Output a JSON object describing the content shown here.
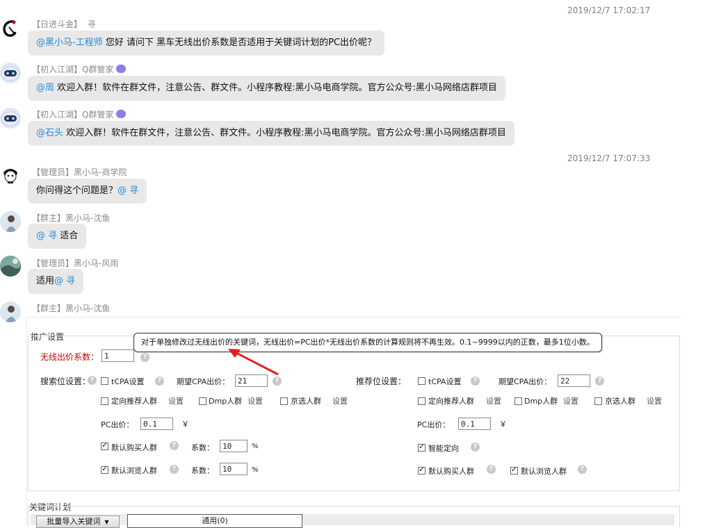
{
  "messages": [
    {
      "id": "m1",
      "timestamp": "2019/12/7 17:02:17",
      "role": "【日进斗金】",
      "name": "寻",
      "mention": "@黑小马-工程师",
      "text": " 您好 请问下 黑车无线出价系数是否适用于关键词计划的PC出价呢？",
      "badge": false
    },
    {
      "id": "m2",
      "role": "【初入江湖】",
      "name": "Q群管家",
      "mention": "@周",
      "text": " 欢迎入群！软件在群文件，注意公告、群文件。小程序教程:黑小马电商学院。官方公众号:黑小马网络店群项目",
      "badge": true
    },
    {
      "id": "m3",
      "role": "【初入江湖】",
      "name": "Q群管家",
      "mention": "@石头",
      "text": " 欢迎入群！软件在群文件，注意公告、群文件。小程序教程:黑小马电商学院。官方公众号:黑小马网络店群项目",
      "badge": true
    },
    {
      "id": "m4",
      "timestamp": "2019/12/7 17:07:33",
      "role": "【管理员】",
      "name": "黑小马-商学院",
      "text": "你问得这个问题是？",
      "mention_after": "@ 寻",
      "badge": false
    },
    {
      "id": "m5",
      "role": "【群主】",
      "name": "黑小马-沈鱼",
      "mention": "@ 寻",
      "text": " 适合",
      "badge": false
    },
    {
      "id": "m6",
      "role": "【管理员】",
      "name": "黑小马-风雨",
      "text": "适用",
      "mention_after": "@ 寻",
      "badge": false
    },
    {
      "id": "m7",
      "role": "【群主】",
      "name": "黑小马-沈鱼"
    }
  ],
  "panel": {
    "title": "推广设置",
    "tooltip": "对于单独修改过无线出价的关键词，无线出价=PC出价*无线出价系数的计算规则将不再生效。0.1~9999以内的正数，最多1位小数。",
    "wireless_label": "无线出价系数：",
    "wireless_value": "1",
    "search": {
      "label": "搜索位设置：",
      "tcpa": "tCPA设置",
      "expected_label": "期望CPA出价：",
      "expected_value": "21",
      "targeted": "定向推荐人群",
      "setting": "设置",
      "dmp": "Dmp人群",
      "jingxuan": "京选人群",
      "pc_label": "PC出价：",
      "pc_value": "0.1",
      "currency": "￥",
      "buyer": "默认购买人群",
      "coef_label": "系数：",
      "buyer_coef": "10",
      "percent": "%",
      "browser": "默认浏览人群",
      "browser_coef": "10"
    },
    "recommend": {
      "label": "推荐位设置：",
      "tcpa": "tCPA设置",
      "expected_label": "期望CPA出价：",
      "expected_value": "22",
      "targeted": "定向推荐人群",
      "setting": "设置",
      "dmp": "Dmp人群",
      "jingxuan": "京选人群",
      "pc_label": "PC出价：",
      "pc_value": "0.1",
      "currency": "￥",
      "smart": "智能定向",
      "buyer": "默认购买人群",
      "browser": "默认浏览人群"
    }
  },
  "keyword": {
    "title": "关键词计划",
    "import_btn": "批量导入关键词",
    "tab_general": "通用(0)"
  },
  "colors": {
    "mention": "#2a8ad4",
    "bubble": "#e8e8e8",
    "required": "#d40000",
    "arrow": "#e02020"
  }
}
